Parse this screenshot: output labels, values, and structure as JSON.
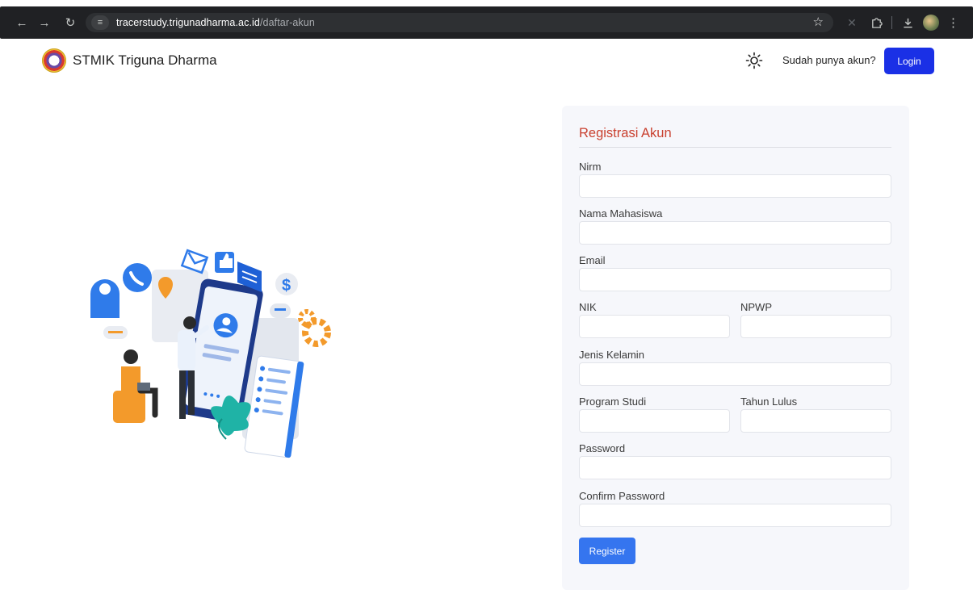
{
  "browser": {
    "url_host": "tracerstudy.trigunadharma.ac.id",
    "url_path": "/daftar-akun"
  },
  "header": {
    "brand": "STMIK Triguna Dharma",
    "have_account": "Sudah punya akun?",
    "login_label": "Login"
  },
  "form": {
    "title": "Registrasi Akun",
    "nirm_label": "Nirm",
    "nama_label": "Nama Mahasiswa",
    "email_label": "Email",
    "nik_label": "NIK",
    "npwp_label": "NPWP",
    "jenis_kelamin_label": "Jenis Kelamin",
    "program_studi_label": "Program Studi",
    "tahun_lulus_label": "Tahun Lulus",
    "password_label": "Password",
    "confirm_password_label": "Confirm Password",
    "register_label": "Register",
    "values": {
      "nirm": "",
      "nama": "",
      "email": "",
      "nik": "",
      "npwp": "",
      "jenis_kelamin": "",
      "program_studi": "",
      "tahun_lulus": "",
      "password": "",
      "confirm_password": ""
    }
  },
  "colors": {
    "login_button": "#1a30e6",
    "register_button": "#3575ef",
    "form_title": "#c9402f",
    "card_background": "#f6f7fb"
  },
  "icons": [
    "back-arrow-icon",
    "forward-arrow-icon",
    "reload-icon",
    "site-info-icon",
    "bookmark-star-icon",
    "extension-icon",
    "puzzle-icon",
    "download-icon",
    "profile-avatar",
    "kebab-menu-icon",
    "sun-icon"
  ]
}
